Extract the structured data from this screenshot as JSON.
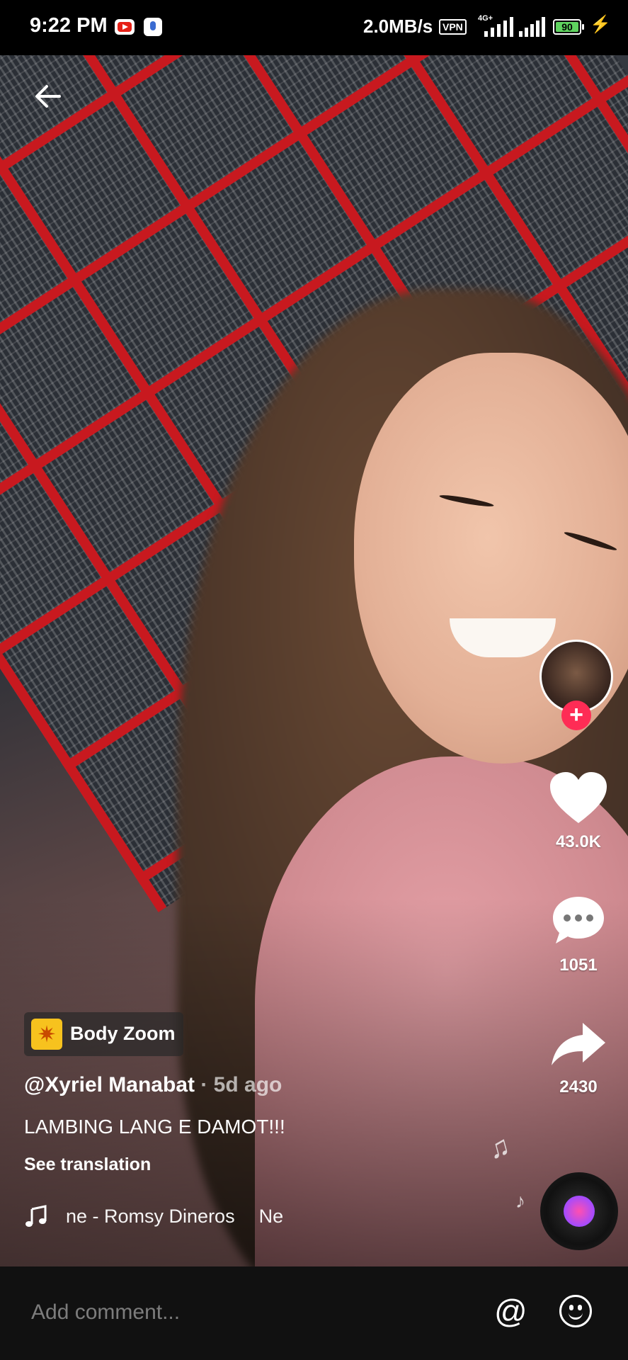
{
  "status_bar": {
    "time": "9:22 PM",
    "speed": "2.0MB/s",
    "vpn": "VPN",
    "network_type": "4G+",
    "battery": "90",
    "icons": [
      "youtube-icon",
      "mic-icon",
      "signal-icon",
      "battery-icon",
      "charging-icon"
    ]
  },
  "video": {
    "creator_avatar": "avatar",
    "follow": "+",
    "likes": "43.0K",
    "comments": "1051",
    "shares": "2430"
  },
  "caption": {
    "effect": "Body Zoom",
    "username": "@Xyriel Manabat",
    "separator": " · ",
    "time": "5d ago",
    "text": "LAMBING LANG E DAMOT!!!",
    "see_translation": "See translation",
    "music_title": "ne - Romsy Dineros",
    "music_title_next": "Ne"
  },
  "comment_bar": {
    "placeholder": "Add comment...",
    "at": "@"
  },
  "colors": {
    "accent_red": "#fe2c55",
    "battery_green": "#5fd35f"
  }
}
